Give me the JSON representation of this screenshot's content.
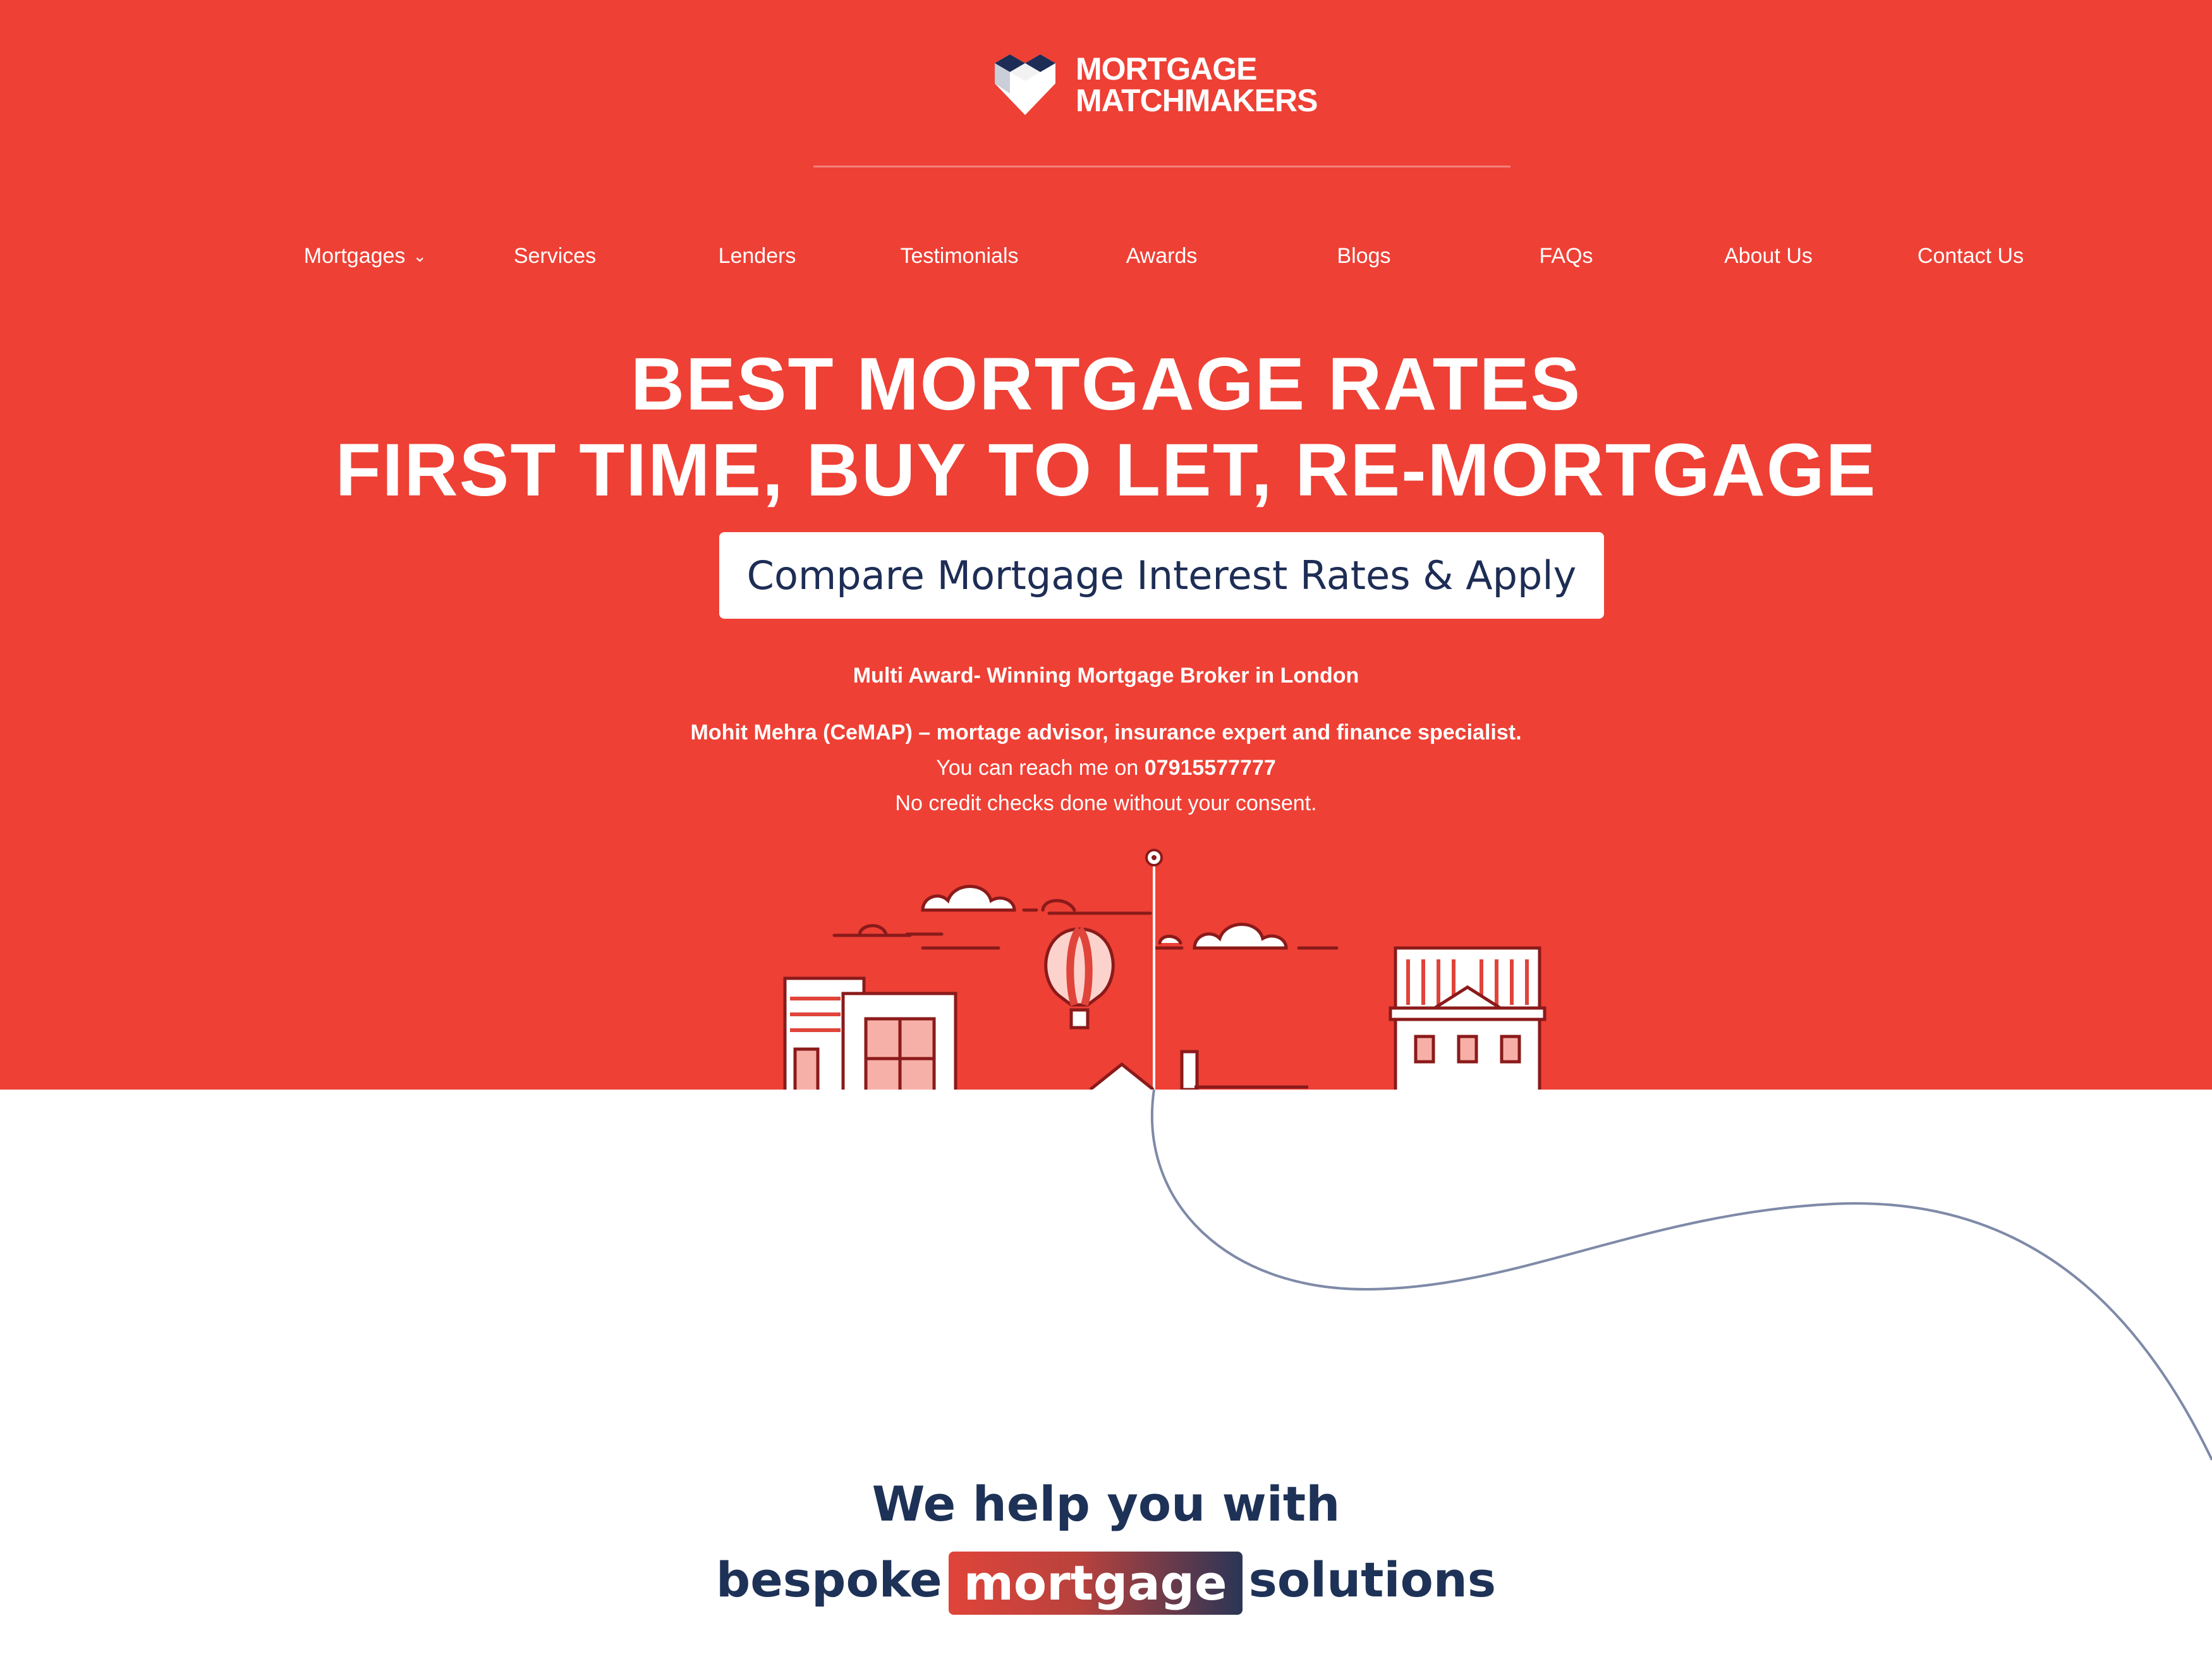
{
  "brand": {
    "line1": "MORTGAGE",
    "line2": "MATCHMAKERS",
    "icon": "heart-home-logo-icon"
  },
  "nav": {
    "items": [
      {
        "label": "Mortgages",
        "has_dropdown": true,
        "dropdown_icon": "chevron-down-icon"
      },
      {
        "label": "Services"
      },
      {
        "label": "Lenders"
      },
      {
        "label": "Testimonials"
      },
      {
        "label": "Awards"
      },
      {
        "label": "Blogs"
      },
      {
        "label": "FAQs"
      },
      {
        "label": "About Us"
      },
      {
        "label": "Contact Us"
      }
    ]
  },
  "hero": {
    "headline_line1": "BEST MORTGAGE RATES",
    "headline_line2": "FIRST TIME, BUY TO LET, RE-MORTGAGE",
    "cta_label": "Compare Mortgage Interest Rates & Apply",
    "award_text": "Multi Award- Winning Mortgage Broker in London",
    "advisor_text": "Mohit Mehra (CeMAP) – mortage advisor, insurance expert and finance specialist.",
    "contact_prefix": "You can reach me on ",
    "phone": "07915577777",
    "consent_text": "No credit checks done without your consent."
  },
  "section": {
    "line1": "We help you with",
    "line2_before": "bespoke",
    "line2_highlight": "mortgage",
    "line2_after": "solutions"
  },
  "colors": {
    "hero_bg": "#ee4035",
    "navy": "#1e3257",
    "white": "#ffffff",
    "illustration_dark": "#8b1a1a"
  }
}
